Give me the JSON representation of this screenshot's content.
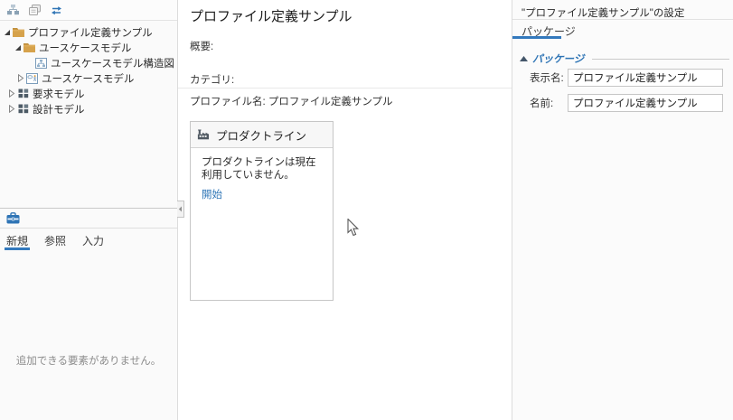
{
  "colors": {
    "accent": "#3379bd",
    "link": "#2e75b6",
    "section_blue": "#2e74b5"
  },
  "explorer": {
    "toolbar_icons": [
      {
        "name": "add-diagram-icon"
      },
      {
        "name": "copy-icon"
      },
      {
        "name": "sync-icon"
      }
    ],
    "tree": [
      {
        "label": "プロファイル定義サンプル",
        "icon": "folder",
        "expander": "expanded",
        "indent": 0
      },
      {
        "label": "ユースケースモデル",
        "icon": "folder",
        "expander": "expanded",
        "indent": 2
      },
      {
        "label": "ユースケースモデル構造図",
        "icon": "diagram",
        "expander": "none",
        "indent": 4
      },
      {
        "label": "ユースケースモデル",
        "icon": "usecase",
        "expander": "collapsed",
        "indent": 3
      },
      {
        "label": "要求モデル",
        "icon": "model",
        "expander": "collapsed",
        "indent": 1
      },
      {
        "label": "設計モデル",
        "icon": "model",
        "expander": "collapsed",
        "indent": 1
      }
    ]
  },
  "toolbox": {
    "tabs": [
      {
        "label": "新規",
        "active": true
      },
      {
        "label": "参照",
        "active": false
      },
      {
        "label": "入力",
        "active": false
      }
    ],
    "empty_message": "追加できる要素がありません。"
  },
  "editor": {
    "title": "プロファイル定義サンプル",
    "overview_label": "概要:",
    "category_label": "カテゴリ:",
    "profile_name_label": "プロファイル名:",
    "profile_name_value": "プロファイル定義サンプル",
    "card": {
      "title": "プロダクトライン",
      "message": "プロダクトラインは現在利用していません。",
      "link_label": "開始"
    }
  },
  "inspector": {
    "title": "\"プロファイル定義サンプル\"の設定",
    "tab_label": "パッケージ",
    "section_label": "パッケージ",
    "fields": [
      {
        "label": "表示名:",
        "value": "プロファイル定義サンプル"
      },
      {
        "label": "名前:",
        "value": "プロファイル定義サンプル"
      }
    ]
  }
}
